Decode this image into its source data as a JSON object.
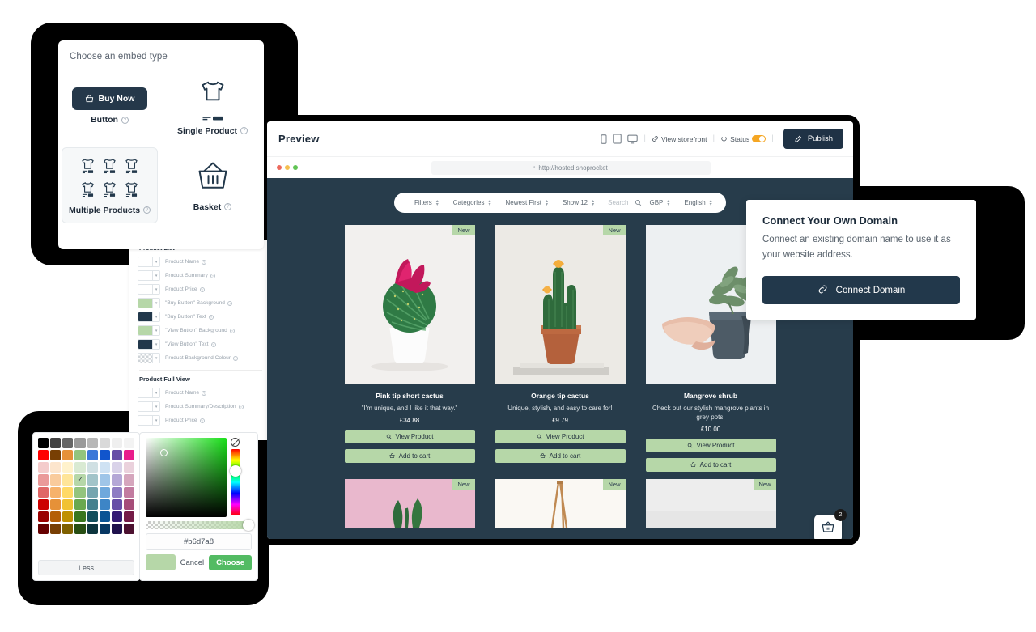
{
  "embed_panel": {
    "title": "Choose an embed type",
    "options": [
      {
        "label": "Button",
        "icon": "buy-now-button-icon",
        "button_label": "Buy Now",
        "selected": false
      },
      {
        "label": "Single Product",
        "icon": "tshirt-icon",
        "selected": false
      },
      {
        "label": "Multiple Products",
        "icon": "tshirt-grid-icon",
        "selected": true
      },
      {
        "label": "Basket",
        "icon": "basket-icon",
        "selected": false
      }
    ],
    "help_glyph": "?"
  },
  "settings_panel": {
    "sections": [
      {
        "heading": "Product List",
        "rows": [
          {
            "label": "Product Name",
            "swatch": "#ffffff"
          },
          {
            "label": "Product Summary",
            "swatch": "#ffffff"
          },
          {
            "label": "Product Price",
            "swatch": "#ffffff"
          },
          {
            "label": "\"Buy Button\" Background",
            "swatch": "#b6d7a8"
          },
          {
            "label": "\"Buy Button\" Text",
            "swatch": "#22384b"
          },
          {
            "label": "\"View Button\" Background",
            "swatch": "#b6d7a8"
          },
          {
            "label": "\"View Button\" Text",
            "swatch": "#22384b"
          },
          {
            "label": "Product Background Colour",
            "swatch": "transparent"
          }
        ]
      },
      {
        "heading": "Product Full View",
        "rows": [
          {
            "label": "Product Name",
            "swatch": "#ffffff"
          },
          {
            "label": "Product Summary/Description",
            "swatch": "#ffffff"
          },
          {
            "label": "Product Price",
            "swatch": "#ffffff"
          }
        ]
      }
    ]
  },
  "color_picker": {
    "less_label": "Less",
    "hex_value": "#b6d7a8",
    "cancel_label": "Cancel",
    "choose_label": "Choose",
    "preview_color": "#b6d7a8",
    "selected_swatch_index": 27,
    "swatches": [
      "#000000",
      "#434343",
      "#666666",
      "#999999",
      "#b7b7b7",
      "#d9d9d9",
      "#efefef",
      "#f3f3f3",
      "#ff0000",
      "#783f04",
      "#e69138",
      "#93c47d",
      "#3c78d8",
      "#1155cc",
      "#674ea7",
      "#e91e8c",
      "#f4cccc",
      "#fce5cd",
      "#fff2cc",
      "#d9ead3",
      "#d0e0e3",
      "#cfe2f3",
      "#d9d2e9",
      "#ead1dc",
      "#ea9999",
      "#f9cb9c",
      "#ffe599",
      "#b6d7a8",
      "#a2c4c9",
      "#9fc5e8",
      "#b4a7d6",
      "#d5a6bd",
      "#e06666",
      "#f6b26b",
      "#ffd966",
      "#93c47d",
      "#76a5af",
      "#6fa8dc",
      "#8e7cc3",
      "#c27ba0",
      "#cc0000",
      "#e69138",
      "#f1c232",
      "#6aa84f",
      "#45818e",
      "#3d85c6",
      "#674ea7",
      "#a64d79",
      "#990000",
      "#b45f06",
      "#bf9000",
      "#38761d",
      "#134f5c",
      "#0b5394",
      "#351c75",
      "#741b47",
      "#660000",
      "#783f04",
      "#7f6000",
      "#274e13",
      "#0c343d",
      "#073763",
      "#20124d",
      "#4c1130"
    ]
  },
  "preview_window": {
    "title": "Preview",
    "device_icons": [
      "mobile-icon",
      "tablet-icon",
      "desktop-icon"
    ],
    "view_storefront_label": "View storefront",
    "status_label": "Status",
    "status_on": true,
    "status_color": "#f5a623",
    "publish_label": "Publish",
    "url": "http://hosted.shoprocket",
    "traffic_lights": [
      "#ed6a5e",
      "#f5bf4f",
      "#61c454"
    ]
  },
  "storefront": {
    "filters": [
      {
        "label": "Filters",
        "type": "select"
      },
      {
        "label": "Categories",
        "type": "select"
      },
      {
        "label": "Newest First",
        "type": "select"
      },
      {
        "label": "Show 12",
        "type": "select"
      }
    ],
    "search_placeholder": "Search",
    "currency": "GBP",
    "language": "English",
    "badge_new": "New",
    "view_product_label": "View Product",
    "add_to_cart_label": "Add to cart",
    "cart_count": "2",
    "accent_button_bg": "#b6d7a8",
    "background": "#273c4b",
    "products": [
      {
        "name": "Pink tip short cactus",
        "summary": "\"I'm unique, and I like it that way.\"",
        "price": "£34.88",
        "image": "pink-flowering-cactus-in-white-pot"
      },
      {
        "name": "Orange tip cactus",
        "summary": "Unique, stylish, and easy to care for!",
        "price": "£9.79",
        "image": "orange-flowering-cactus-in-terracotta-pot"
      },
      {
        "name": "Mangrove shrub",
        "summary": "Check out our stylish mangrove plants in grey pots!",
        "price": "£10.00",
        "image": "hand-holding-grey-pot-with-shrub"
      }
    ],
    "products_row2": [
      {
        "image": "plant-on-pink-background"
      },
      {
        "image": "plant-with-wooden-stand"
      },
      {
        "image": "plant-on-light-grey-background"
      }
    ]
  },
  "domain_card": {
    "title": "Connect Your Own Domain",
    "body": "Connect an existing domain name to use it as your website address.",
    "button_label": "Connect Domain",
    "button_icon": "link-icon"
  }
}
